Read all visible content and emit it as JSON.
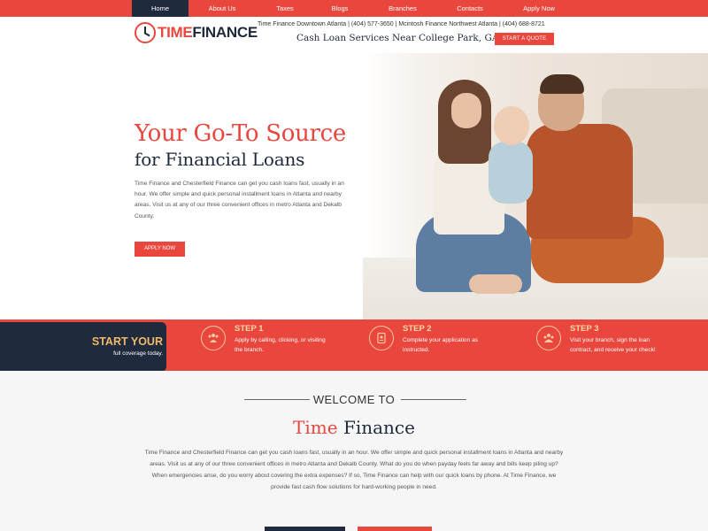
{
  "nav": {
    "items": [
      "Home",
      "About Us",
      "Taxes",
      "Blogs",
      "Branches",
      "Contacts",
      "Apply Now"
    ],
    "active": "Home"
  },
  "header": {
    "logo_part1": "TIME",
    "logo_part2": "FINANCE",
    "contacts": "Time Finance Downtown Atlanta | (404) 577-3650 | Mcintosh Finance Northwest Atlanta | (404) 688-8721",
    "tagline": "Cash Loan Services Near College Park, GA",
    "quote_button": "START A QUOTE"
  },
  "hero": {
    "title_line1": "Your Go-To Source",
    "title_line2": "for Financial Loans",
    "text": "Time Finance and Chesterfield Finance can get you cash loans fast, usually in an hour. We offer simple and quick personal installment loans in Atlanta and nearby areas. Visit us at any of our three convenient offices in metro Atlanta and Dekalb County.",
    "apply_button": "APPLY NOW"
  },
  "steps": {
    "start_title": "START YOUR",
    "start_sub": "full coverage today.",
    "items": [
      {
        "label": "STEP 1",
        "desc": "Apply by calling, clicking, or visiting the branch.",
        "icon": "people-icon"
      },
      {
        "label": "STEP 2",
        "desc": "Complete your application as instructed.",
        "icon": "document-icon"
      },
      {
        "label": "STEP 3",
        "desc": "Visit your branch, sign the loan contract, and receive your check!",
        "icon": "group-icon"
      }
    ]
  },
  "welcome": {
    "heading": "WELCOME TO",
    "brand1": "Time",
    "brand2": "Finance",
    "text": "Time Finance and Chesterfield Finance can get you cash loans fast, usually in an hour. We offer simple and quick personal installment loans in Atlanta and nearby areas. Visit us at any of our three convenient offices in metro Atlanta and Dekalb County. What do you do when payday feels far away and bills keep piling up? When emergencies arise, do you worry about covering the extra expenses? If so, Time Finance can help with our quick loans by phone. At Time Finance, we provide fast cash flow solutions for hard-working people in need."
  },
  "colors": {
    "accent": "#e9473e",
    "navy": "#1f2a3c",
    "gold": "#f2b96a"
  }
}
